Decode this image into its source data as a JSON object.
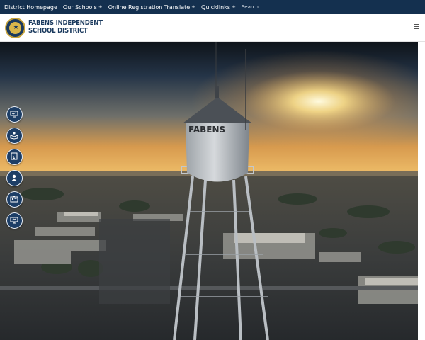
{
  "topbar": {
    "items": [
      {
        "label": "District Homepage",
        "has_menu": false
      },
      {
        "label": "Our Schools",
        "has_menu": true
      },
      {
        "label": "Online Registration Translate",
        "has_menu": true
      },
      {
        "label": "Quicklinks",
        "has_menu": true
      }
    ],
    "search_label": "Search",
    "plus_glyph": "+"
  },
  "header": {
    "district_name_line1": "FABENS INDEPENDENT",
    "district_name_line2": "SCHOOL DISTRICT",
    "logo_icon": "district-seal-icon",
    "menu_icon": "hamburger-menu-icon"
  },
  "hero": {
    "image": "water-tower-sunset-photo",
    "tower_text": "FABENS"
  },
  "quicknav": {
    "icons": [
      "monitor-icon",
      "book-reader-icon",
      "tablet-hand-icon",
      "person-icon",
      "id-card-icon",
      "computer-icon"
    ]
  },
  "colors": {
    "topbar_bg": "#14304f",
    "brand_navy": "#1b3a5e",
    "brand_gold": "#c9a43a",
    "quicknav_bg": "#1d3e66"
  }
}
